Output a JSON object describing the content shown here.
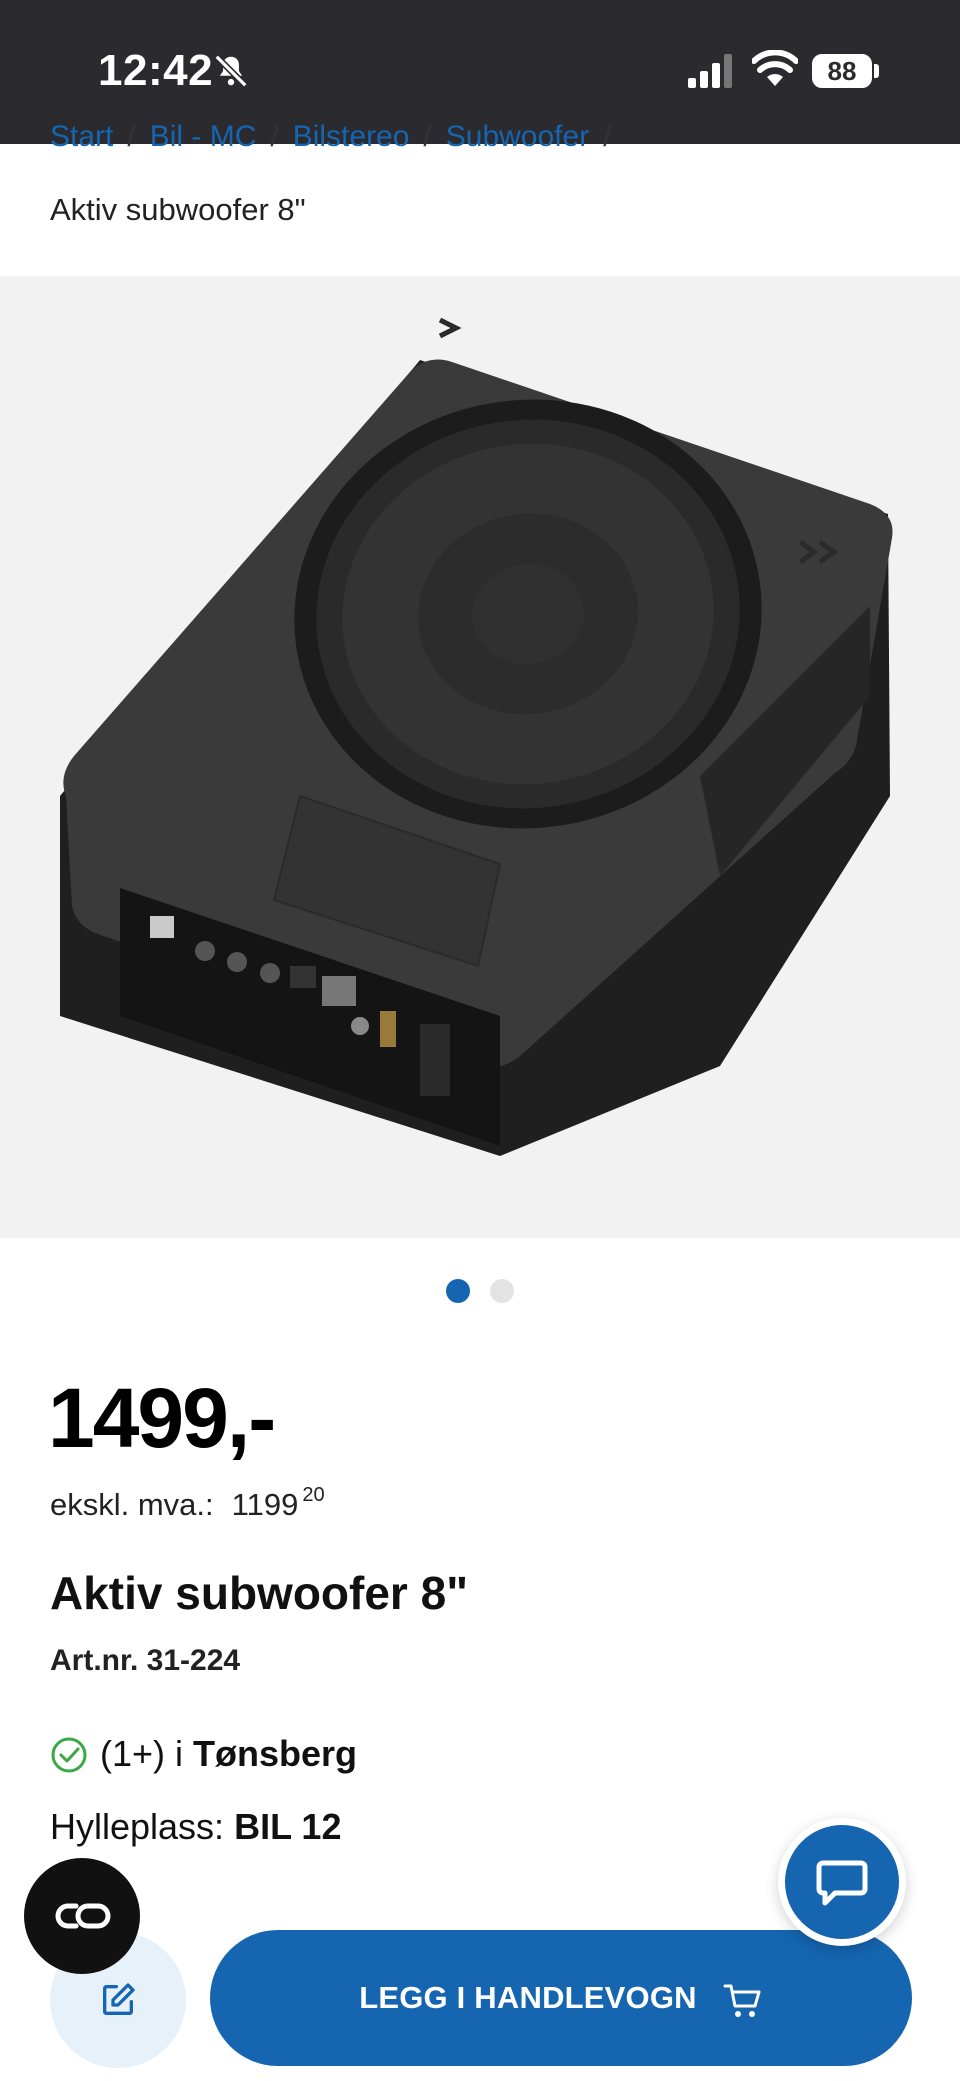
{
  "status_bar": {
    "time": "12:42",
    "battery": "88"
  },
  "breadcrumb": {
    "items": [
      "Start",
      "Bil - MC",
      "Bilstereo",
      "Subwoofer"
    ],
    "separator": "/",
    "current": "Aktiv subwoofer 8\""
  },
  "gallery": {
    "total": 2,
    "active": 1
  },
  "product": {
    "price": "1499,-",
    "ex_vat_label": "ekskl. mva.:",
    "ex_vat_whole": "1199",
    "ex_vat_cents": "20",
    "title": "Aktiv subwoofer 8\"",
    "article_number": "Art.nr. 31-224",
    "stock_count": "(1+) i",
    "stock_store": "Tønsberg",
    "shelf_label": "Hylleplass:",
    "shelf_value": "BIL 12"
  },
  "actions": {
    "add_to_cart": "LEGG I HANDLEVOGN"
  },
  "icons": {
    "bell": "bell-slash-icon",
    "signal": "cellular-signal-icon",
    "wifi": "wifi-icon",
    "check": "check-circle-icon",
    "co": "co-logo-icon",
    "chat": "chat-bubble-icon",
    "edit": "edit-note-icon",
    "cart": "cart-icon"
  },
  "colors": {
    "accent": "#1565b0",
    "status_bar": "#2b2b2f",
    "in_stock": "#3aa845"
  }
}
